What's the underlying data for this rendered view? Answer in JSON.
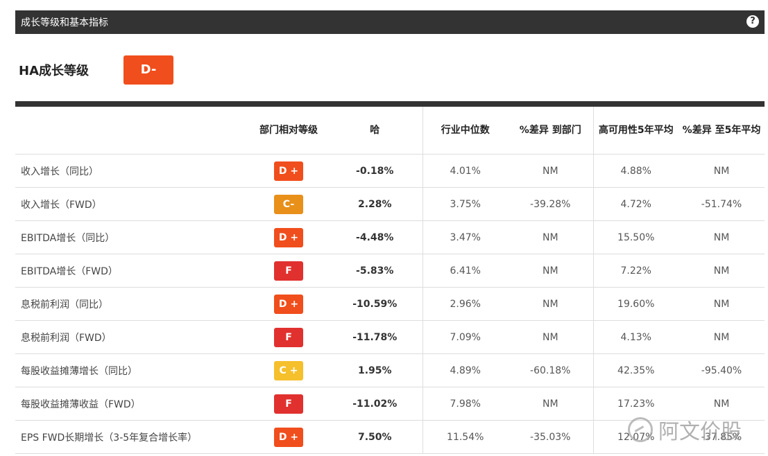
{
  "header": {
    "title": "成长等级和基本指标",
    "help": "?"
  },
  "grade": {
    "label": "HA成长等级",
    "value": "D-",
    "color": "#f04e1c"
  },
  "table": {
    "columns": [
      "",
      "部门相对等级",
      "哈",
      "行业中位数",
      "%差异 到部门",
      "高可用性5年平均",
      "%差异 至5年平均"
    ],
    "rows": [
      {
        "metric": "收入增长（同比）",
        "grade": "D +",
        "grade_color": "#f04e1c",
        "ha": "-0.18%",
        "median": "4.01%",
        "diff_sector": "NM",
        "avg5": "4.88%",
        "diff_avg5": "NM"
      },
      {
        "metric": "收入增长（FWD）",
        "grade": "C-",
        "grade_color": "#e8901a",
        "ha": "2.28%",
        "median": "3.75%",
        "diff_sector": "-39.28%",
        "avg5": "4.72%",
        "diff_avg5": "-51.74%"
      },
      {
        "metric": "EBITDA增长（同比）",
        "grade": "D +",
        "grade_color": "#f04e1c",
        "ha": "-4.48%",
        "median": "3.47%",
        "diff_sector": "NM",
        "avg5": "15.50%",
        "diff_avg5": "NM"
      },
      {
        "metric": "EBITDA增长（FWD）",
        "grade": "F",
        "grade_color": "#e0312f",
        "ha": "-5.83%",
        "median": "6.41%",
        "diff_sector": "NM",
        "avg5": "7.22%",
        "diff_avg5": "NM"
      },
      {
        "metric": "息税前利润（同比）",
        "grade": "D +",
        "grade_color": "#f04e1c",
        "ha": "-10.59%",
        "median": "2.96%",
        "diff_sector": "NM",
        "avg5": "19.60%",
        "diff_avg5": "NM"
      },
      {
        "metric": "息税前利润（FWD）",
        "grade": "F",
        "grade_color": "#e0312f",
        "ha": "-11.78%",
        "median": "7.09%",
        "diff_sector": "NM",
        "avg5": "4.13%",
        "diff_avg5": "NM"
      },
      {
        "metric": "每股收益摊薄增长（同比）",
        "grade": "C +",
        "grade_color": "#f5c02c",
        "ha": "1.95%",
        "median": "4.89%",
        "diff_sector": "-60.18%",
        "avg5": "42.35%",
        "diff_avg5": "-95.40%"
      },
      {
        "metric": "每股收益摊薄收益（FWD）",
        "grade": "F",
        "grade_color": "#e0312f",
        "ha": "-11.02%",
        "median": "7.98%",
        "diff_sector": "NM",
        "avg5": "17.23%",
        "diff_avg5": "NM"
      },
      {
        "metric": "EPS FWD长期增长（3-5年复合增长率）",
        "grade": "D +",
        "grade_color": "#f04e1c",
        "ha": "7.50%",
        "median": "11.54%",
        "diff_sector": "-35.03%",
        "avg5": "12.07%",
        "diff_avg5": "-37.85%"
      }
    ]
  },
  "watermark": "阿文价股"
}
